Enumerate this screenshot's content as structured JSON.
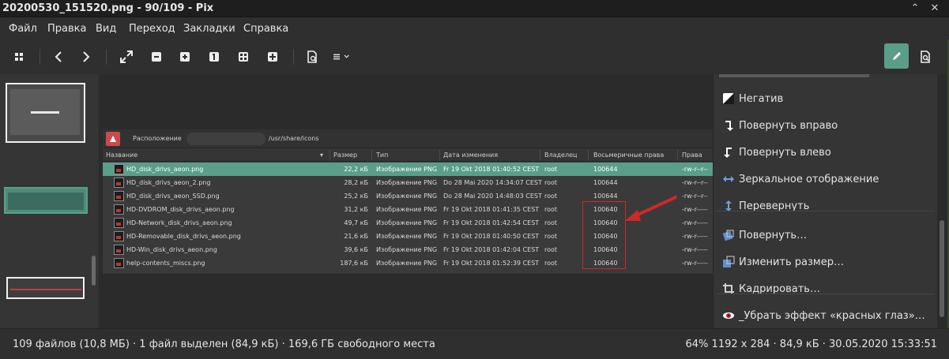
{
  "window": {
    "title": "20200530_151520.png - 90/109 - Pix",
    "controls": [
      "chevron-up-icon",
      "close-icon"
    ]
  },
  "menu": [
    "Файл",
    "Правка",
    "Вид",
    "Переход",
    "Закладки",
    "Справка"
  ],
  "toolbar": {
    "buttons": [
      "grid-icon",
      "prev-icon",
      "next-icon",
      "fullscreen-icon",
      "zoom-out-icon",
      "zoom-in-icon",
      "zoom-1-icon",
      "zoom-fit-icon",
      "zoom-fit-width-icon",
      "properties-icon",
      "menu-icon",
      "edit-icon",
      "info-icon"
    ]
  },
  "screenshot": {
    "location_label": "Расположение",
    "location_path": "/usr/share/icons",
    "columns": [
      "Название",
      "Размер",
      "Тип",
      "Дата изменения",
      "Владелец",
      "Восьмеричные права",
      "Права"
    ],
    "rows": [
      {
        "name": "HD_disk_drivs_aeon.png",
        "size": "22,2 кБ",
        "type": "Изображение PNG",
        "date": "Fr 19 Okt 2018 01:40:52 CEST",
        "owner": "root",
        "octal": "100644",
        "perm": "-rw-r--r--",
        "selected": true
      },
      {
        "name": "HD_disk_drivs_aeon_2.png",
        "size": "28,2 кБ",
        "type": "Изображение PNG",
        "date": "Do 28 Mai 2020 14:34:07 CEST",
        "owner": "root",
        "octal": "100644",
        "perm": "-rw-r--r--"
      },
      {
        "name": "HD_disk_drivs_aeon_SSD.png",
        "size": "25,2 кБ",
        "type": "Изображение PNG",
        "date": "Do 28 Mai 2020 14:48:03 CEST",
        "owner": "root",
        "octal": "100644",
        "perm": "-rw-r--r--"
      },
      {
        "name": "HD-DVDROM_disk_drivs_aeon.png",
        "size": "31,2 кБ",
        "type": "Изображение PNG",
        "date": "Fr 19 Okt 2018 01:41:35 CEST",
        "owner": "root",
        "octal": "100640",
        "perm": "-rw-r-----"
      },
      {
        "name": "HD-Network_disk_drivs_aeon.png",
        "size": "49,7 кБ",
        "type": "Изображение PNG",
        "date": "Fr 19 Okt 2018 01:42:54 CEST",
        "owner": "root",
        "octal": "100640",
        "perm": "-rw-r-----"
      },
      {
        "name": "HD-Removable_disk_drivs_aeon.png",
        "size": "21,6 кБ",
        "type": "Изображение PNG",
        "date": "Fr 19 Okt 2018 01:40:50 CEST",
        "owner": "root",
        "octal": "100640",
        "perm": "-rw-r-----"
      },
      {
        "name": "HD-Win_disk_drivs_aeon.png",
        "size": "39,6 кБ",
        "type": "Изображение PNG",
        "date": "Fr 19 Okt 2018 01:42:04 CEST",
        "owner": "root",
        "octal": "100640",
        "perm": "-rw-r-----"
      },
      {
        "name": "help-contents_miscs.png",
        "size": "187,6 кБ",
        "type": "Изображение PNG",
        "date": "Fr 19 Okt 2018 01:52:39 CEST",
        "owner": "root",
        "octal": "100640",
        "perm": "-rw-r-----"
      }
    ],
    "highlight_color": "#d02828"
  },
  "tools": [
    {
      "label": "Негатив",
      "icon": "negative-icon"
    },
    {
      "label": "Повернуть вправо",
      "icon": "rotate-right-icon"
    },
    {
      "label": "Повернуть влево",
      "icon": "rotate-left-icon"
    },
    {
      "label": "Зеркальное отображение",
      "icon": "mirror-icon"
    },
    {
      "label": "Перевернуть",
      "icon": "flip-icon"
    },
    {
      "label": "Повернуть…",
      "icon": "rotate-icon"
    },
    {
      "label": "Изменить размер…",
      "icon": "resize-icon"
    },
    {
      "label": "Кадрировать…",
      "icon": "crop-icon"
    },
    {
      "label": "_Убрать эффект «красных глаз»…",
      "icon": "red-eye-icon"
    }
  ],
  "status": {
    "left": "109 файлов (10,8 МБ) · 1 файл выделен (84,9 кБ) · 169,6 ГБ свободного места",
    "right": "64%  1192 x 284 · 84,9 кБ · 30.05.2020 15:33:51"
  },
  "colors": {
    "accent": "#5a9e8a",
    "background": "#2f2f2f",
    "annotation_red": "#d02828"
  }
}
